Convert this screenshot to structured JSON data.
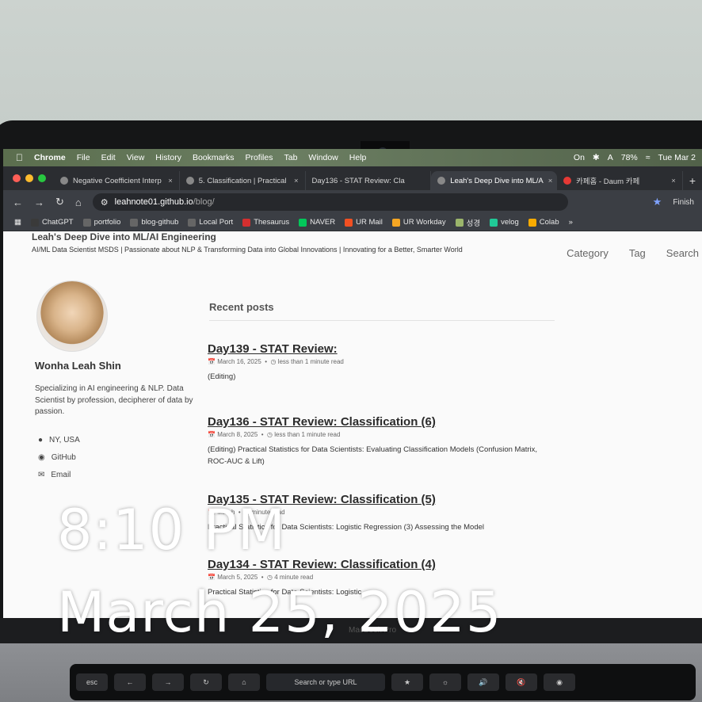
{
  "menubar": {
    "app_name": "Chrome",
    "items": [
      "File",
      "Edit",
      "View",
      "History",
      "Bookmarks",
      "Profiles",
      "Tab",
      "Window",
      "Help"
    ],
    "battery": "78%",
    "focus_label": "On",
    "input_indicator": "A",
    "datetime": "Tue Mar 2"
  },
  "tabs": [
    {
      "label": "Negative Coefficient Interp"
    },
    {
      "label": "5. Classification | Practical"
    },
    {
      "label": "Day136 - STAT Review: Cla"
    },
    {
      "label": "Leah's Deep Dive into ML/A"
    },
    {
      "label": "카페홈 - Daum 카페"
    }
  ],
  "toolbar": {
    "url_host": "leahnote01.github.io",
    "url_path": "/blog/"
  },
  "bookmarks": [
    {
      "label": "ChatGPT",
      "color": "#3a3a3a"
    },
    {
      "label": "portfolio",
      "color": "#666666"
    },
    {
      "label": "blog-github",
      "color": "#666666"
    },
    {
      "label": "Local Port",
      "color": "#666666"
    },
    {
      "label": "Thesaurus",
      "color": "#d32f2f"
    },
    {
      "label": "NAVER",
      "color": "#03c75a"
    },
    {
      "label": "UR Mail",
      "color": "#f25022"
    },
    {
      "label": "UR Workday",
      "color": "#f5a623"
    },
    {
      "label": "성경",
      "color": "#9bb56b"
    },
    {
      "label": "velog",
      "color": "#20c997"
    },
    {
      "label": "Colab",
      "color": "#f9ab00"
    }
  ],
  "bookmarks_overflow": "»",
  "finish_label": "Finish",
  "site": {
    "title": "Leah's Deep Dive into ML/AI Engineering",
    "tagline": "AI/ML Data Scientist MSDS | Passionate about NLP & Transforming Data into Global Innovations | Innovating for a Better, Smarter World",
    "nav": [
      "Category",
      "Tag",
      "Search"
    ]
  },
  "author": {
    "name": "Wonha Leah Shin",
    "bio": "Specializing in AI engineering & NLP. Data Scientist by profession, decipherer of data by passion.",
    "location": "NY, USA",
    "github": "GitHub",
    "email": "Email"
  },
  "recent": {
    "heading": "Recent posts",
    "posts": [
      {
        "title": "Day139 - STAT Review:",
        "date": "March 16, 2025",
        "read": "less than 1 minute read",
        "excerpt": "(Editing)"
      },
      {
        "title": "Day136 - STAT Review: Classification (6)",
        "date": "March 8, 2025",
        "read": "less than 1 minute read",
        "excerpt": "(Editing) Practical Statistics for Data Scientists: Evaluating Classification Models (Confusion Matrix, ROC-AUC & Lift)"
      },
      {
        "title": "Day135 - STAT Review: Classification (5)",
        "date": "March",
        "read": "minute read",
        "excerpt": "Practical Statistics for Data Scientists: Logistic Regression (3) Assessing the Model"
      },
      {
        "title": "Day134 - STAT Review: Classification (4)",
        "date": "March 5, 2025",
        "read": "4 minute read",
        "excerpt": "Practical Statistics for Data Scientists: Logistic"
      }
    ]
  },
  "laptop_brand": "MacBook Pro",
  "touchbar": {
    "esc": "esc",
    "search": "Search or type URL"
  },
  "overlay": {
    "time": "8:10 PM",
    "date": "March 25, 2025"
  }
}
